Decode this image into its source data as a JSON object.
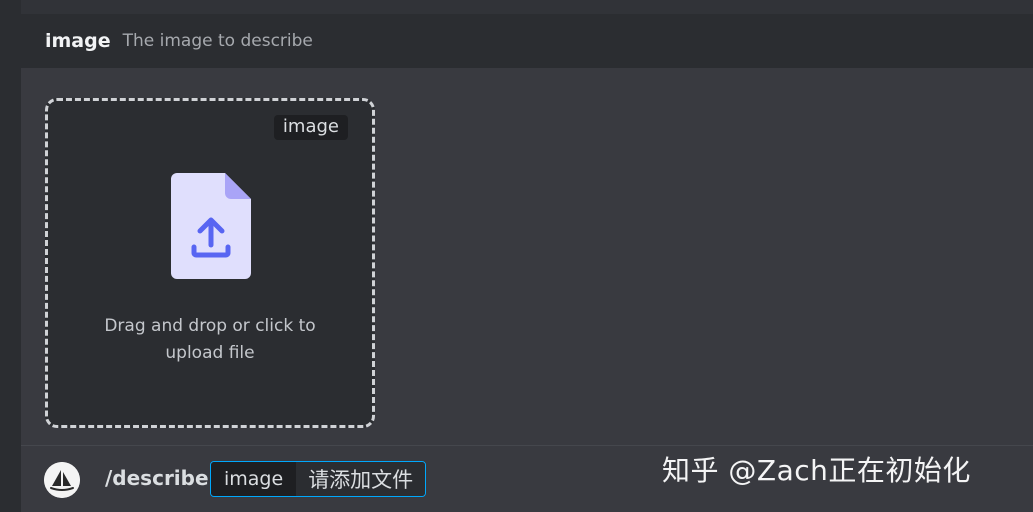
{
  "option_header": {
    "name": "image",
    "description": "The image to describe"
  },
  "dropzone": {
    "type_badge": "image",
    "line1": "Drag and drop or click to",
    "line2": "upload file",
    "icon": "file-upload-icon"
  },
  "command_bar": {
    "command": "/describe",
    "option_name": "image",
    "option_value": "请添加文件",
    "avatar_icon": "sailboat-logo-icon"
  },
  "watermark": "知乎 @Zach正在初始化",
  "colors": {
    "background": "#313338",
    "panel": "#393a40",
    "header": "#2b2d31",
    "file_icon": "#e0dffd",
    "file_icon_accent": "#5865f2",
    "focus_border": "#00a8fc"
  }
}
